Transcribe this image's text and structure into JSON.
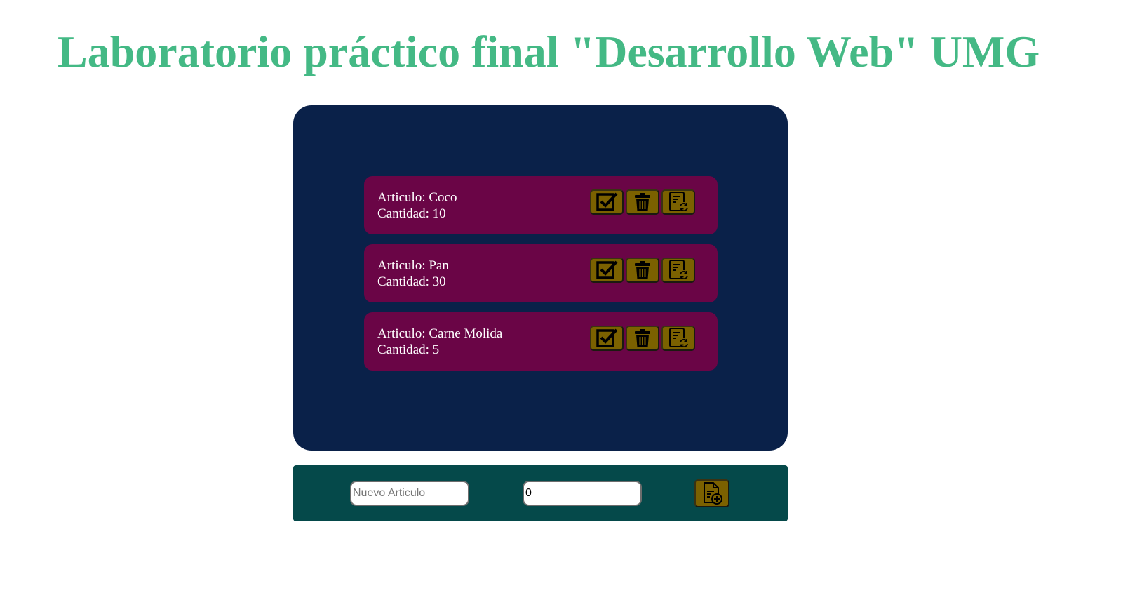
{
  "page": {
    "title": "Laboratorio práctico final \"Desarrollo Web\" UMG"
  },
  "colors": {
    "title": "#44b985",
    "list_panel": "#0a2149",
    "item_card": "#6a0546",
    "action_button": "#7b6100",
    "form_bar": "#05494a"
  },
  "items": [
    {
      "articulo": "Articulo: Coco",
      "cantidad": "Cantidad: 10"
    },
    {
      "articulo": "Articulo: Pan",
      "cantidad": "Cantidad: 30"
    },
    {
      "articulo": "Articulo: Carne Molida",
      "cantidad": "Cantidad: 5"
    }
  ],
  "item_action_icons": [
    "check-square-icon",
    "trash-icon",
    "document-refresh-icon"
  ],
  "form": {
    "name_placeholder": "Nuevo Articulo",
    "name_value": "",
    "quantity_value": "0",
    "add_icon": "document-add-icon"
  }
}
